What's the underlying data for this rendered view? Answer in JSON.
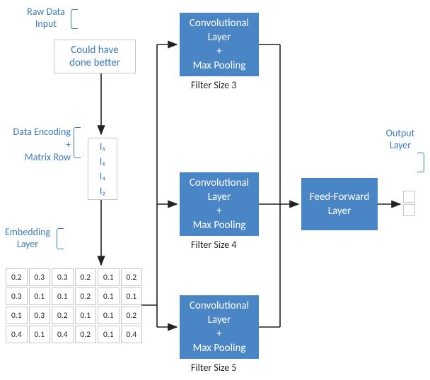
{
  "chart_data": {
    "type": "diagram",
    "title": "",
    "nodes": [
      {
        "id": "raw-input",
        "label": "Could have done better",
        "annotation": "Raw Data Input"
      },
      {
        "id": "encoding",
        "values": [
          "I5",
          "I6",
          "I4",
          "I2"
        ],
        "annotation": "Data Encoding + Matrix Row"
      },
      {
        "id": "embedding-matrix",
        "annotation": "Embedding Layer",
        "rows": 4,
        "cols": 6,
        "values": [
          [
            0.2,
            0.3,
            0.3,
            0.2,
            0.1,
            0.2
          ],
          [
            0.3,
            0.1,
            0.1,
            0.2,
            0.1,
            0.1
          ],
          [
            0.1,
            0.3,
            0.2,
            0.1,
            0.1,
            0.2
          ],
          [
            0.4,
            0.1,
            0.4,
            0.2,
            0.1,
            0.4
          ]
        ]
      },
      {
        "id": "conv-3",
        "label": "Convolutional Layer + Max Pooling",
        "filter_size": 3
      },
      {
        "id": "conv-4",
        "label": "Convolutional Layer + Max Pooling",
        "filter_size": 4
      },
      {
        "id": "conv-5",
        "label": "Convolutional Layer + Max Pooling",
        "filter_size": 5
      },
      {
        "id": "ff",
        "label": "Feed-Forward Layer"
      },
      {
        "id": "output",
        "annotation": "Output Layer",
        "units": 2
      }
    ],
    "edges": [
      [
        "raw-input",
        "encoding"
      ],
      [
        "encoding",
        "embedding-matrix"
      ],
      [
        "embedding-matrix",
        "conv-3"
      ],
      [
        "embedding-matrix",
        "conv-4"
      ],
      [
        "embedding-matrix",
        "conv-5"
      ],
      [
        "conv-3",
        "ff"
      ],
      [
        "conv-4",
        "ff"
      ],
      [
        "conv-5",
        "ff"
      ],
      [
        "ff",
        "output"
      ]
    ]
  },
  "labels": {
    "raw_data": "Raw Data\nInput",
    "raw_text": "Could have\ndone better",
    "encoding_annot_line1": "Data Encoding",
    "encoding_annot_plus": "+",
    "encoding_annot_line2": "Matrix Row",
    "embedding_annot": "Embedding\nLayer",
    "conv_label": "Convolutional\nLayer\n+\nMax Pooling",
    "filter3": "Filter Size 3",
    "filter4": "Filter Size 4",
    "filter5": "Filter Size 5",
    "ff": "Feed-Forward\nLayer",
    "output_annot": "Output\nLayer"
  },
  "encoding_items": [
    "I₅",
    "I₆",
    "I₄",
    "I₂"
  ],
  "matrix_flat": [
    "0.2",
    "0.3",
    "0.3",
    "0.2",
    "0.1",
    "0.2",
    "0.3",
    "0.1",
    "0.1",
    "0.2",
    "0.1",
    "0.1",
    "0.1",
    "0.3",
    "0.2",
    "0.1",
    "0.1",
    "0.2",
    "0.4",
    "0.1",
    "0.4",
    "0.2",
    "0.1",
    "0.4"
  ],
  "colors": {
    "accent": "#3b7bbf",
    "box": "#4a86c5",
    "arrow": "#222"
  }
}
